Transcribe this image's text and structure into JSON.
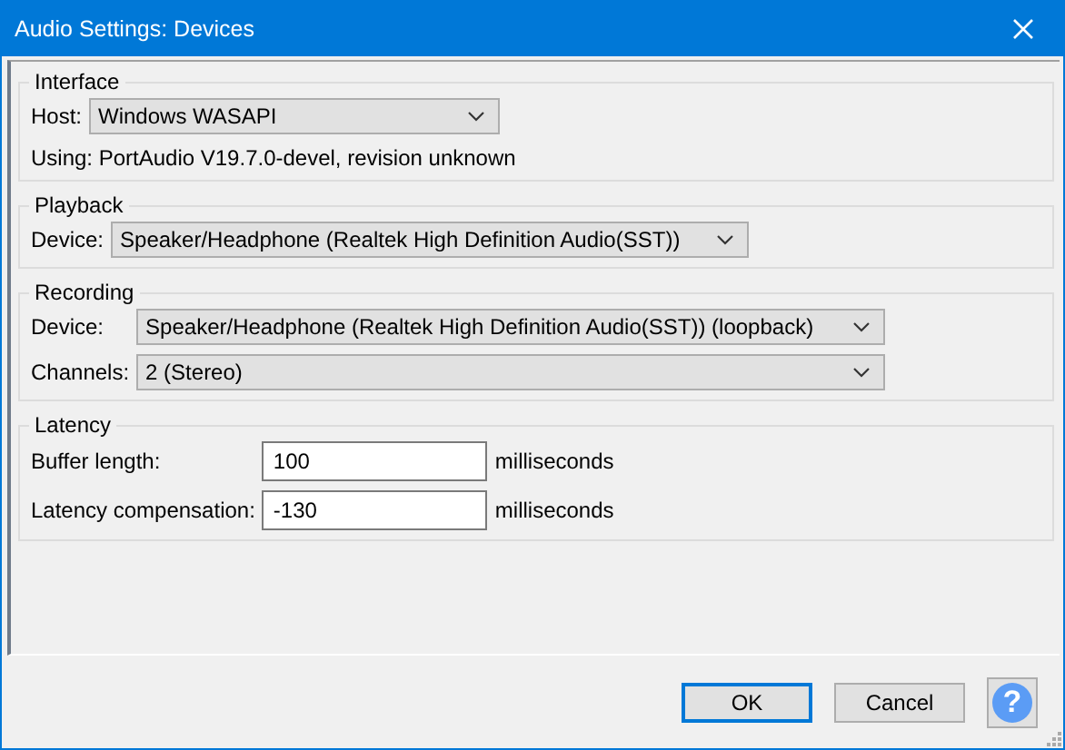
{
  "window": {
    "title": "Audio Settings: Devices"
  },
  "sections": [
    {
      "title": "Interface",
      "rows": [
        {
          "kind": "select",
          "label": "Host:",
          "value": "Windows WASAPI"
        },
        {
          "kind": "text",
          "text": "Using: PortAudio V19.7.0-devel, revision unknown"
        }
      ]
    },
    {
      "title": "Playback",
      "rows": [
        {
          "kind": "select",
          "label": "Device:",
          "value": "Speaker/Headphone (Realtek High Definition Audio(SST))"
        }
      ]
    },
    {
      "title": "Recording",
      "rows": [
        {
          "kind": "select",
          "label": "Device:",
          "value": "Speaker/Headphone (Realtek High Definition Audio(SST)) (loopback)"
        },
        {
          "kind": "select",
          "label": "Channels:",
          "value": "2 (Stereo)"
        }
      ]
    },
    {
      "title": "Latency",
      "rows": [
        {
          "kind": "input",
          "label": "Buffer length:",
          "value": "100",
          "unit": "milliseconds"
        },
        {
          "kind": "input",
          "label": "Latency compensation:",
          "value": "-130",
          "unit": "milliseconds"
        }
      ]
    }
  ],
  "buttons": [
    {
      "label": "OK",
      "default": true
    },
    {
      "label": "Cancel",
      "default": false
    }
  ],
  "help": {
    "label": "?"
  }
}
